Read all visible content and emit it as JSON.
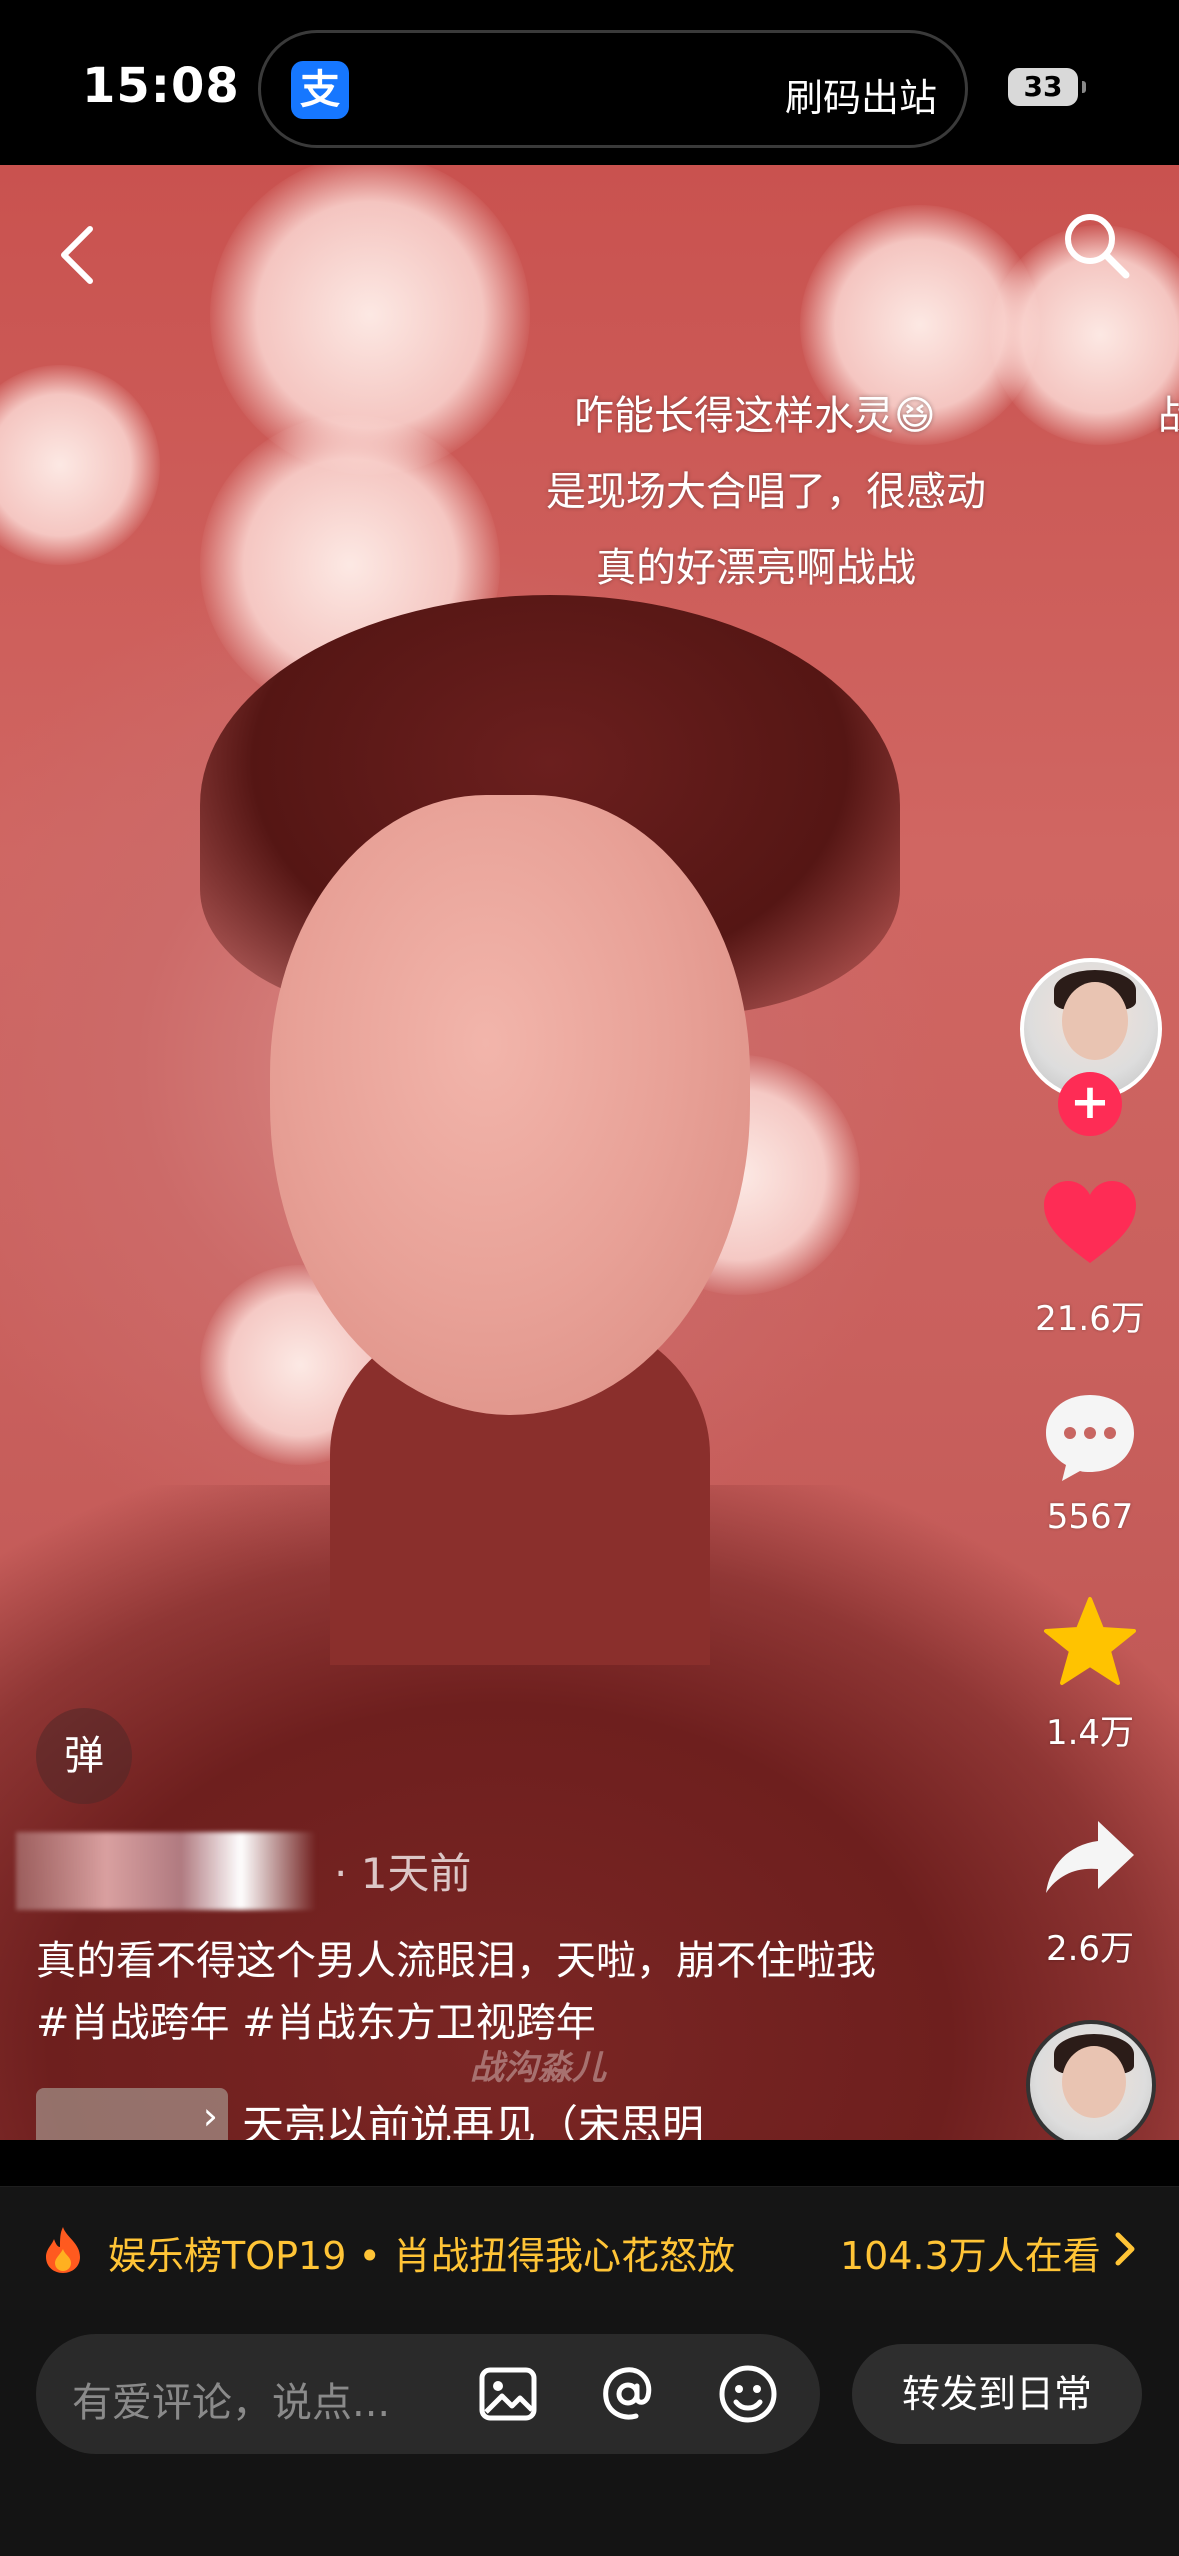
{
  "status_bar": {
    "time": "15:08",
    "alipay_glyph": "支",
    "island_label": "刷码出站",
    "battery": "33"
  },
  "danmaku": [
    "咋能长得这样水灵😆",
    "战",
    "是现场大合唱了，很感动",
    "真的好漂亮啊战战"
  ],
  "side_actions": {
    "likes": "21.6万",
    "comments": "5567",
    "favorites": "1.4万",
    "shares": "2.6万"
  },
  "danmu_toggle": "弹",
  "post": {
    "time_ago": "· 1天前",
    "caption": "真的看不得这个男人流眼泪，天啦，崩不住啦我#肖战跨年 #肖战东方卫视跨年",
    "music_title": "天亮以前说再见（宋思明",
    "watermark": "战沟淼儿"
  },
  "hot_bar": {
    "title": "娱乐榜TOP19 • 肖战扭得我心花怒放",
    "viewers": "104.3万人在看"
  },
  "comment_bar": {
    "placeholder": "有爱评论，说点...",
    "share_button": "转发到日常"
  },
  "colors": {
    "like": "#fe2c55",
    "favorite": "#ffc300",
    "hot_accent": "#ffc436",
    "alipay": "#1677ff"
  }
}
